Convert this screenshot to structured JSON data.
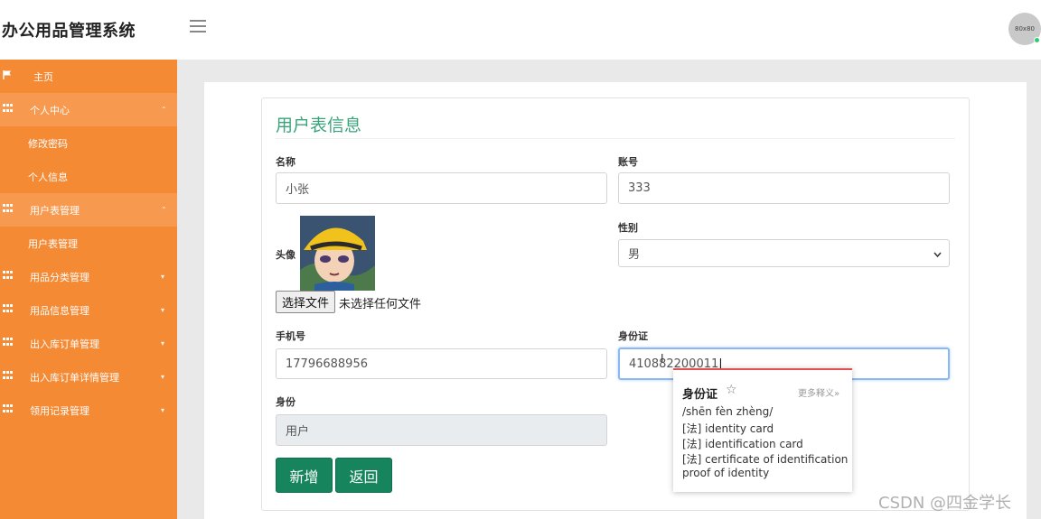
{
  "app": {
    "title": "办公用品管理系统",
    "avatar_text": "80x80"
  },
  "sidebar": {
    "items": [
      {
        "label": "主页",
        "icon": "flag-icon"
      },
      {
        "label": "个人中心",
        "icon": "grid-icon",
        "arrow": "⌃"
      },
      {
        "label": "修改密码"
      },
      {
        "label": "个人信息"
      },
      {
        "label": "用户表管理",
        "icon": "grid-icon",
        "arrow": "⌃"
      },
      {
        "label": "用户表管理"
      },
      {
        "label": "用品分类管理",
        "icon": "grid-icon",
        "arrow": "▾"
      },
      {
        "label": "用品信息管理",
        "icon": "grid-icon",
        "arrow": "▾"
      },
      {
        "label": "出入库订单管理",
        "icon": "grid-icon",
        "arrow": "▾"
      },
      {
        "label": "出入库订单详情管理",
        "icon": "grid-icon",
        "arrow": "▾"
      },
      {
        "label": "领用记录管理",
        "icon": "grid-icon",
        "arrow": "▾"
      }
    ]
  },
  "form": {
    "title": "用户表信息",
    "name_label": "名称",
    "name_value": "小张",
    "account_label": "账号",
    "account_value": "333",
    "avatar_label": "头像",
    "file_button": "选择文件",
    "file_note": "未选择任何文件",
    "gender_label": "性别",
    "gender_value": "男",
    "phone_label": "手机号",
    "phone_value": "17796688956",
    "idcard_label": "身份证",
    "idcard_value": "410882200011",
    "role_label": "身份",
    "role_value": "用户",
    "add_button": "新增",
    "back_button": "返回"
  },
  "dictionary_popup": {
    "word": "身份证",
    "more": "更多释义»",
    "pinyin": "/shēn fèn zhèng/",
    "defs": [
      "[法] identity card",
      "[法] identification card",
      "[法] certificate of identification",
      "proof of identity"
    ]
  },
  "watermark": "CSDN @四金学长",
  "colors": {
    "sidebar": "#f58a35",
    "accent_green": "#16855e",
    "title_green": "#3aa57a"
  }
}
